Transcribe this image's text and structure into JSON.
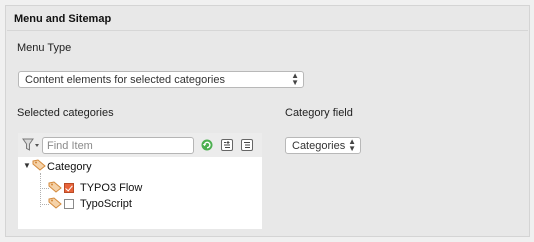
{
  "panel": {
    "title": "Menu and Sitemap",
    "menu_type_label": "Menu Type",
    "menu_type_value": "Content elements for selected categories",
    "selected_categories_label": "Selected categories",
    "category_field_label": "Category field",
    "category_field_value": "Categories"
  },
  "tree": {
    "search_placeholder": "Find Item",
    "filter_icon": "filter-icon",
    "toolbar_icons": [
      "refresh-icon",
      "expand-all-icon",
      "collapse-all-icon"
    ],
    "root": {
      "label": "Category",
      "icon": "category-tag-icon"
    },
    "items": [
      {
        "label": "TYPO3 Flow",
        "checked": true
      },
      {
        "label": "TypoScript",
        "checked": false
      }
    ]
  },
  "colors": {
    "panel_bg": "#e8e8e8",
    "checkbox_accent": "#e8643a",
    "refresh_icon": "#4caf50",
    "category_icon": "#e7a35c"
  }
}
